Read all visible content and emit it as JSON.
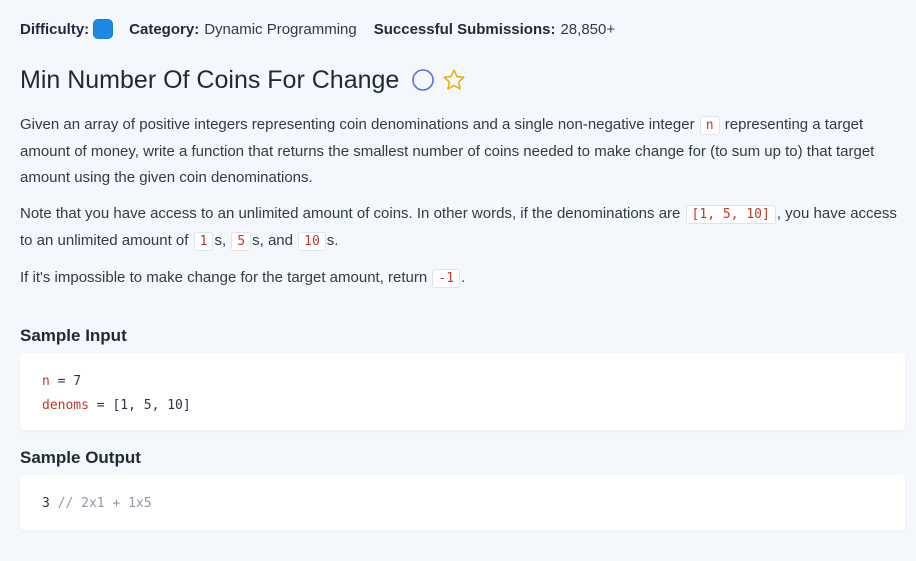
{
  "meta": {
    "difficulty_label": "Difficulty:",
    "difficulty_color": "#1e88e5",
    "category_label": "Category:",
    "category_value": "Dynamic Programming",
    "submissions_label": "Successful Submissions:",
    "submissions_value": "28,850+"
  },
  "title": "Min Number Of Coins For Change",
  "icons": {
    "completion": "circle-outline-icon",
    "favorite": "star-outline-icon"
  },
  "description": {
    "p1_a": "Given an array of positive integers representing coin denominations and a single non-negative integer ",
    "p1_code": "n",
    "p1_b": " representing a target amount of money, write a function that returns the smallest number of coins needed to make change for (to sum up to) that target amount using the given coin denominations.",
    "p2_a": "Note that you have access to an unlimited amount of coins. In other words, if the denominations are ",
    "p2_code1": "[1, 5, 10]",
    "p2_b": ", you have access to an unlimited amount of ",
    "p2_code2": "1",
    "p2_c": "s, ",
    "p2_code3": "5",
    "p2_d": "s, and ",
    "p2_code4": "10",
    "p2_e": "s.",
    "p3_a": "If it's impossible to make change for the target amount, return ",
    "p3_code": "-1",
    "p3_b": "."
  },
  "sample_input": {
    "label": "Sample Input",
    "line1_name": "n",
    "line1_rest": " = 7",
    "line2_name": "denoms",
    "line2_rest": " = [1, 5, 10]"
  },
  "sample_output": {
    "label": "Sample Output",
    "value": "3",
    "comment": " // 2x1 + 1x5"
  }
}
